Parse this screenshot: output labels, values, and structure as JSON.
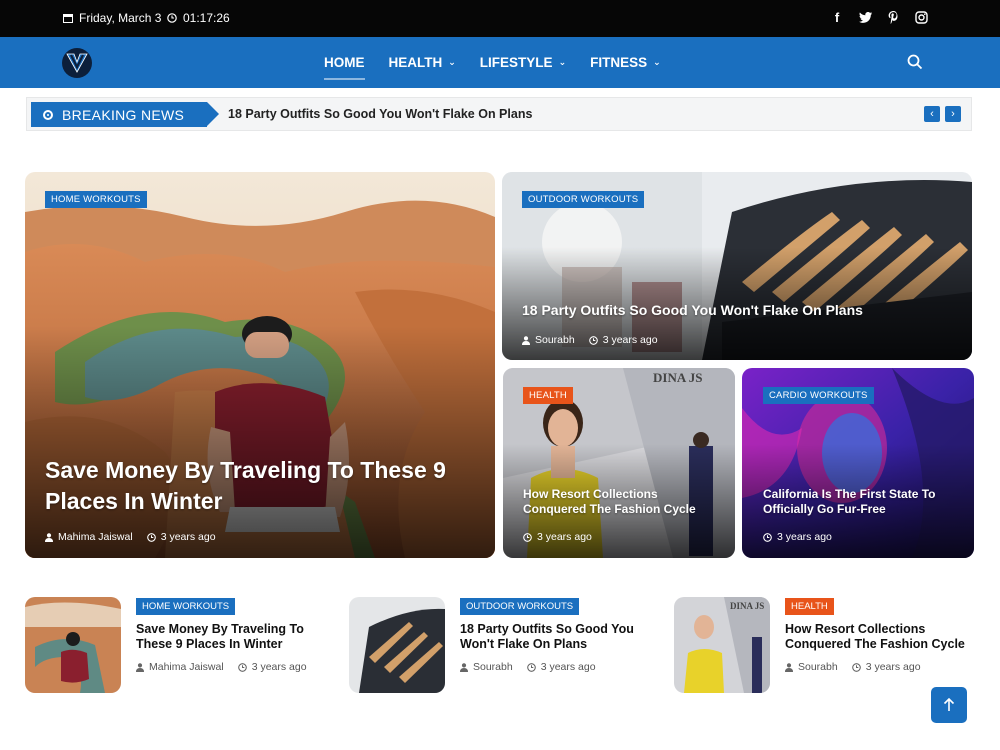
{
  "topbar": {
    "date": "Friday, March 3",
    "time": "01:17:26",
    "socials": [
      "facebook-icon",
      "twitter-icon",
      "pinterest-icon",
      "instagram-icon"
    ]
  },
  "nav": {
    "items": [
      {
        "label": "HOME",
        "dropdown": false
      },
      {
        "label": "HEALTH",
        "dropdown": true
      },
      {
        "label": "LIFESTYLE",
        "dropdown": true
      },
      {
        "label": "FITNESS",
        "dropdown": true
      }
    ]
  },
  "breaking": {
    "label": "BREAKING NEWS",
    "headline": "18 Party Outfits So Good You Won't Flake On Plans"
  },
  "featured": {
    "main": {
      "category": "HOME WORKOUTS",
      "title": "Save Money By Traveling To These 9 Places In Winter",
      "author": "Mahima Jaiswal",
      "time": "3 years ago"
    },
    "top_right": {
      "category": "OUTDOOR WORKOUTS",
      "title": "18 Party Outfits So Good You Won't Flake On Plans",
      "author": "Sourabh",
      "time": "3 years ago"
    },
    "bottom_left": {
      "category": "HEALTH",
      "title": "How Resort Collections Conquered The Fashion Cycle",
      "time": "3 years ago"
    },
    "bottom_right": {
      "category": "CARDIO WORKOUTS",
      "title": "California Is The First State To Officially Go Fur-Free",
      "time": "3 years ago"
    }
  },
  "list": [
    {
      "category": "HOME WORKOUTS",
      "title": "Save Money By Traveling To These 9 Places In Winter",
      "author": "Mahima Jaiswal",
      "time": "3 years ago"
    },
    {
      "category": "OUTDOOR WORKOUTS",
      "title": "18 Party Outfits So Good You Won't Flake On Plans",
      "author": "Sourabh",
      "time": "3 years ago"
    },
    {
      "category": "HEALTH",
      "title": "How Resort Collections Conquered The Fashion Cycle",
      "author": "Sourabh",
      "time": "3 years ago"
    }
  ],
  "colors": {
    "brand": "#1a6fbf",
    "health_badge": "#e8541a",
    "topbar": "#060606"
  }
}
